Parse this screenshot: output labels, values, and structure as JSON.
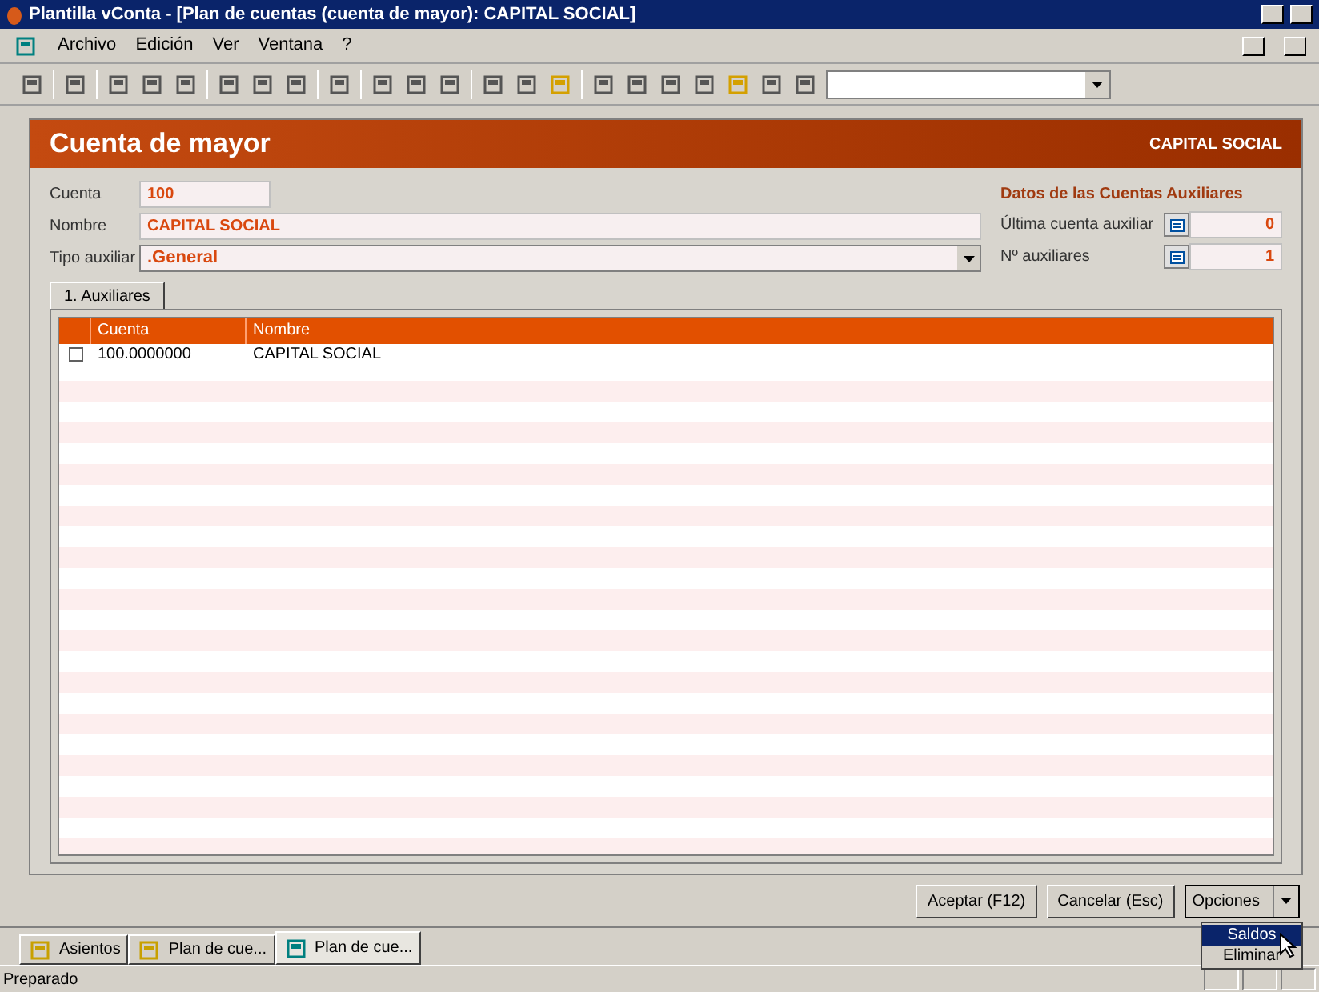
{
  "window": {
    "title": "Plantilla vConta - [Plan de cuentas (cuenta de mayor): CAPITAL SOCIAL]"
  },
  "menu": [
    "Archivo",
    "Edición",
    "Ver",
    "Ventana",
    "?"
  ],
  "header": {
    "title": "Cuenta de mayor",
    "subtitle": "CAPITAL SOCIAL"
  },
  "form": {
    "fields": [
      {
        "label": "Cuenta",
        "value": "100",
        "kind": "short"
      },
      {
        "label": "Nombre",
        "value": "CAPITAL SOCIAL",
        "kind": "wide"
      },
      {
        "label": "Tipo auxiliar",
        "value": ".General",
        "kind": "select"
      }
    ],
    "aux": {
      "title": "Datos de las Cuentas Auxiliares",
      "fields": [
        {
          "label": "Última cuenta auxiliar",
          "value": "0"
        },
        {
          "label": "Nº auxiliares",
          "value": "1"
        }
      ]
    }
  },
  "tabs": [
    {
      "label": "1. Auxiliares",
      "selected": true
    }
  ],
  "table": {
    "columns": [
      "Cuenta",
      "Nombre"
    ],
    "rows": [
      {
        "checked": false,
        "cells": [
          "100.0000000",
          "CAPITAL SOCIAL"
        ]
      }
    ]
  },
  "buttons": [
    "Aceptar (F12)",
    "Cancelar (Esc)"
  ],
  "options": {
    "label": "Opciones",
    "items": [
      {
        "label": "Saldos",
        "selected": true
      },
      {
        "label": "Eliminar",
        "selected": false
      }
    ]
  },
  "window_tabs": [
    {
      "label": "Asientos",
      "selected": false
    },
    {
      "label": "Plan de cue...",
      "selected": false
    },
    {
      "label": "Plan de cue...",
      "selected": true
    }
  ],
  "status_bar": {
    "text": "Preparado"
  }
}
